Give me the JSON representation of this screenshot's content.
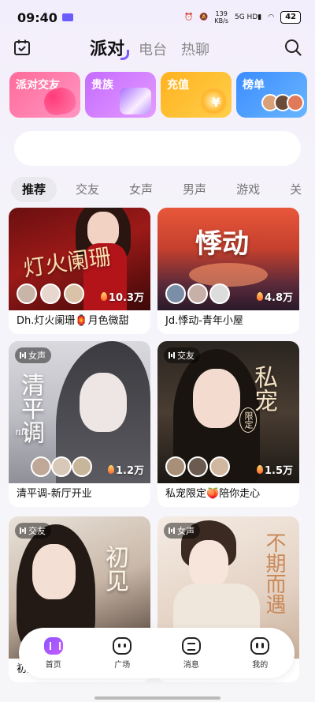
{
  "status_bar": {
    "time": "09:40",
    "net_speed": "139",
    "net_unit": "KB/s",
    "signal": "5G HD",
    "battery": "42"
  },
  "header": {
    "tabs": [
      {
        "label": "派对"
      },
      {
        "label": "电台"
      },
      {
        "label": "热聊"
      }
    ]
  },
  "quick_cards": [
    {
      "label": "派对交友"
    },
    {
      "label": "贵族"
    },
    {
      "label": "充值"
    },
    {
      "label": "榜单"
    }
  ],
  "categories": [
    {
      "label": "推荐"
    },
    {
      "label": "交友"
    },
    {
      "label": "女声"
    },
    {
      "label": "男声"
    },
    {
      "label": "游戏"
    },
    {
      "label": "关"
    }
  ],
  "rooms": [
    {
      "title": "Dh.灯火阑珊🏮月色微甜",
      "heat": "10.3万",
      "tag": "",
      "poster_text": "灯火阑珊"
    },
    {
      "title": "Jd.悸动-青年小屋",
      "heat": "4.8万",
      "tag": "",
      "poster_text": "悸动"
    },
    {
      "title": "清平调-新厅开业",
      "heat": "1.2万",
      "tag": "女声",
      "poster_text": "清平调"
    },
    {
      "title": "私宠限定🍑陪你走心",
      "heat": "1.5万",
      "tag": "交友",
      "poster_text": "私宠"
    },
    {
      "title": "初见",
      "heat": "",
      "tag": "交友",
      "poster_text": "初见"
    },
    {
      "title": "",
      "heat": "",
      "tag": "女声",
      "poster_text": "不期而遇"
    }
  ],
  "poster_small": {
    "nice": "nice",
    "limited": "限定"
  },
  "bottom_nav": [
    {
      "label": "首页"
    },
    {
      "label": "广场"
    },
    {
      "label": "消息"
    },
    {
      "label": "我的"
    }
  ],
  "colors": {
    "accent": "#8c54ff",
    "party_card": "#ff6b9a",
    "noble_card": "#c46bff",
    "recharge_card": "#ffb21f",
    "rank_card": "#3c8cff"
  }
}
